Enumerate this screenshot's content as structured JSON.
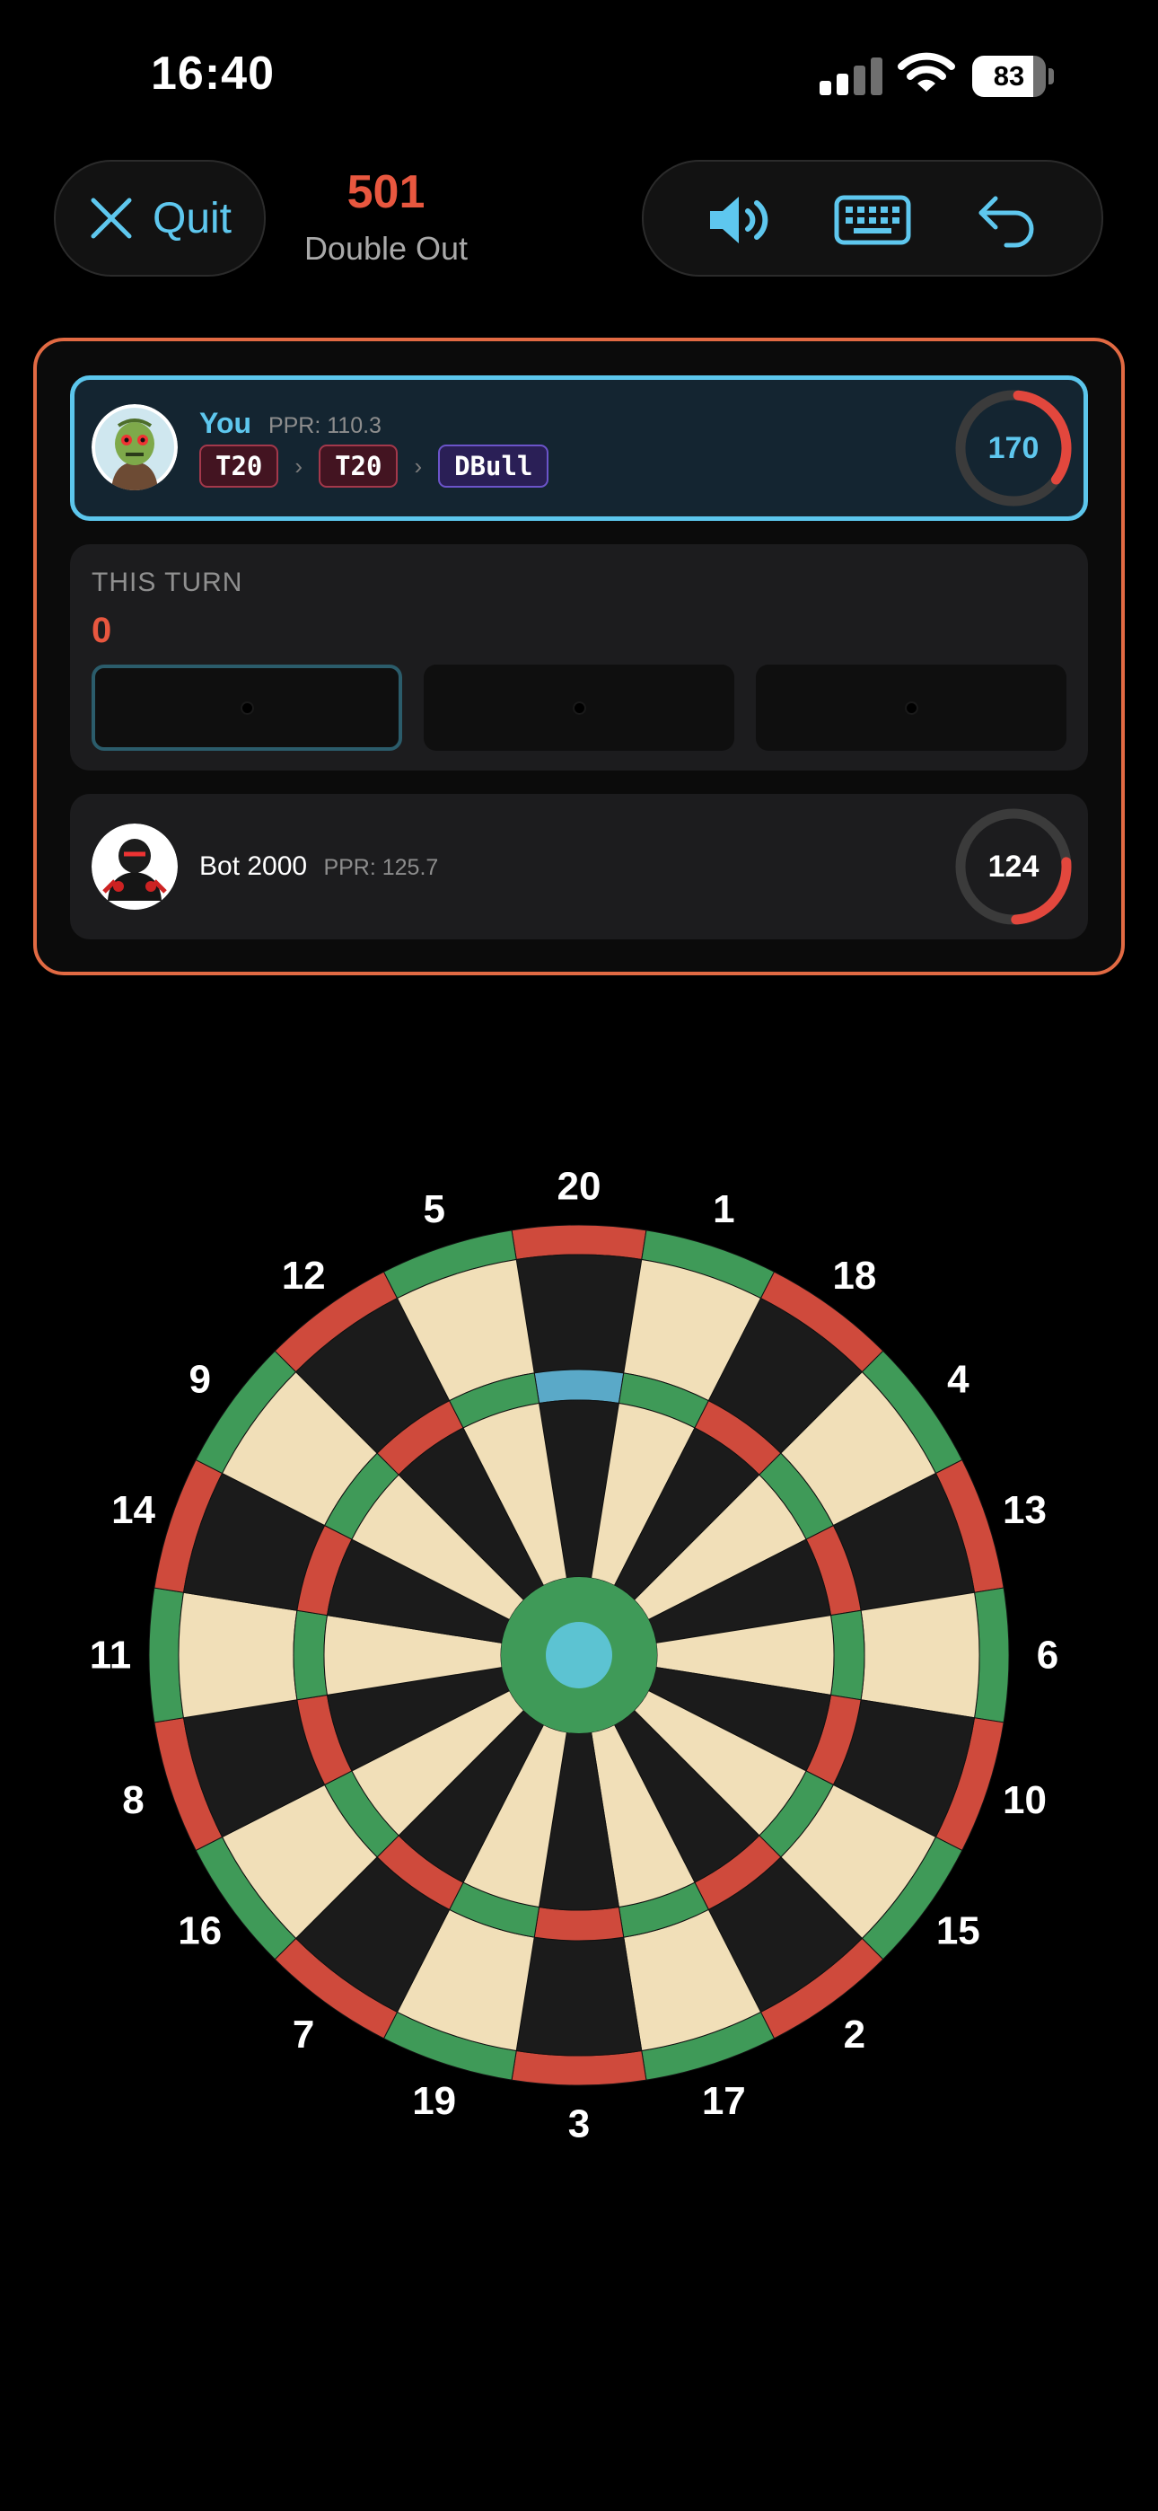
{
  "status_bar": {
    "time": "16:40",
    "battery": "83"
  },
  "header": {
    "quit_label": "Quit",
    "game_score": "501",
    "game_mode": "Double Out"
  },
  "players": {
    "you": {
      "name": "You",
      "ppr": "PPR: 110.3",
      "remaining": "170",
      "checkout": [
        "T20",
        "T20",
        "DBull"
      ]
    },
    "bot": {
      "name": "Bot 2000",
      "ppr": "PPR: 125.7",
      "remaining": "124"
    }
  },
  "turn": {
    "title": "THIS TURN",
    "total": "0"
  },
  "board": {
    "numbers": [
      "20",
      "1",
      "18",
      "4",
      "13",
      "6",
      "10",
      "15",
      "2",
      "17",
      "3",
      "19",
      "7",
      "16",
      "8",
      "11",
      "14",
      "9",
      "12",
      "5"
    ],
    "highlight_segment": "20"
  },
  "colors": {
    "accent_blue": "#5ec7ee",
    "accent_orange": "#e26a43",
    "board_red": "#cf4a3c",
    "board_green": "#3f9a58",
    "board_cream": "#f1dfb8",
    "board_black": "#1b1b1b"
  }
}
